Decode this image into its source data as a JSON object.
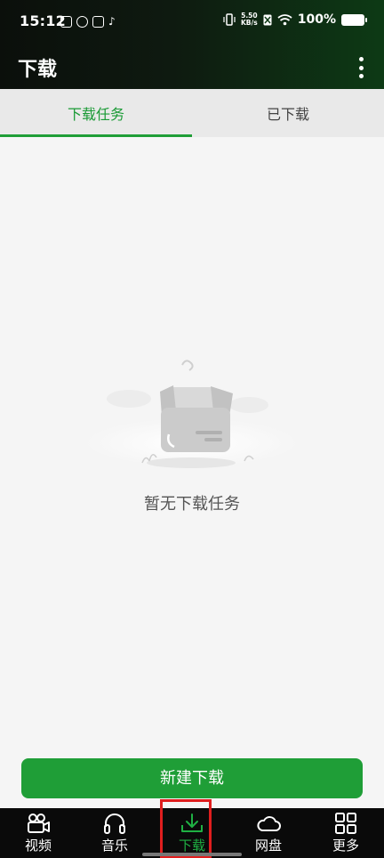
{
  "status_bar": {
    "time": "15:12",
    "net_speed_value": "5.50",
    "net_speed_unit": "KB/s",
    "battery": "100%"
  },
  "header": {
    "title": "下载",
    "menu_icon": "more-vertical-icon"
  },
  "tabs": [
    {
      "label": "下载任务",
      "active": true
    },
    {
      "label": "已下载",
      "active": false
    }
  ],
  "empty_state": {
    "message": "暂无下载任务",
    "illustration": "empty-box-icon"
  },
  "new_download_button": {
    "label": "新建下载"
  },
  "bottom_nav": [
    {
      "label": "视频",
      "icon": "video-camera-icon",
      "active": false
    },
    {
      "label": "音乐",
      "icon": "headphones-icon",
      "active": false
    },
    {
      "label": "下载",
      "icon": "download-icon",
      "active": true
    },
    {
      "label": "网盘",
      "icon": "cloud-icon",
      "active": false
    },
    {
      "label": "更多",
      "icon": "grid-icon",
      "active": false
    }
  ],
  "colors": {
    "accent": "#1f9e37",
    "highlight_box": "#e01e1e",
    "nav_background": "#0a0a0a"
  }
}
